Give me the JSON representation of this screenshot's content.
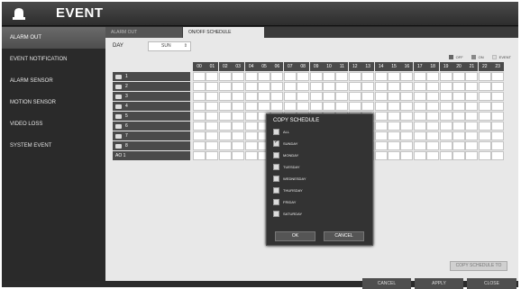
{
  "header": {
    "title": "EVENT",
    "icon": "alarm-bell-icon"
  },
  "sidebar": {
    "items": [
      {
        "label": "ALARM OUT",
        "active": true
      },
      {
        "label": "EVENT NOTIFICATION",
        "active": false
      },
      {
        "label": "ALARM SENSOR",
        "active": false
      },
      {
        "label": "MOTION SENSOR",
        "active": false
      },
      {
        "label": "VIDEO LOSS",
        "active": false
      },
      {
        "label": "SYSTEM EVENT",
        "active": false
      }
    ]
  },
  "tabs": [
    {
      "label": "ALARM OUT",
      "active": false
    },
    {
      "label": "ON/OFF SCHEDULE",
      "active": true
    }
  ],
  "schedule": {
    "day_label": "DAY",
    "day_value": "SUN",
    "legend": [
      {
        "label": "OFF",
        "color": "#666666"
      },
      {
        "label": "ON",
        "color": "#888888"
      },
      {
        "label": "EVENT",
        "color": "#dddddd"
      }
    ],
    "hours": [
      "00",
      "01",
      "02",
      "03",
      "04",
      "05",
      "06",
      "07",
      "08",
      "09",
      "10",
      "11",
      "12",
      "13",
      "14",
      "15",
      "16",
      "17",
      "18",
      "19",
      "20",
      "21",
      "22",
      "23"
    ],
    "rows": [
      "1",
      "2",
      "3",
      "4",
      "5",
      "6",
      "7",
      "8",
      "AO 1"
    ]
  },
  "copy_dialog": {
    "title": "COPY SCHEDULE",
    "options": [
      {
        "label": "ALL",
        "checked": false
      },
      {
        "label": "SUNDAY",
        "checked": true
      },
      {
        "label": "MONDAY",
        "checked": false
      },
      {
        "label": "TUESDAY",
        "checked": false
      },
      {
        "label": "WEDNESDAY",
        "checked": false
      },
      {
        "label": "THURSDAY",
        "checked": false
      },
      {
        "label": "FRIDAY",
        "checked": false
      },
      {
        "label": "SATURDAY",
        "checked": false
      }
    ],
    "ok_label": "OK",
    "cancel_label": "CANCEL"
  },
  "copy_schedule_button": "COPY SCHEDULE TO",
  "footer": {
    "cancel": "CANCEL",
    "apply": "APPLY",
    "close": "CLOSE"
  }
}
